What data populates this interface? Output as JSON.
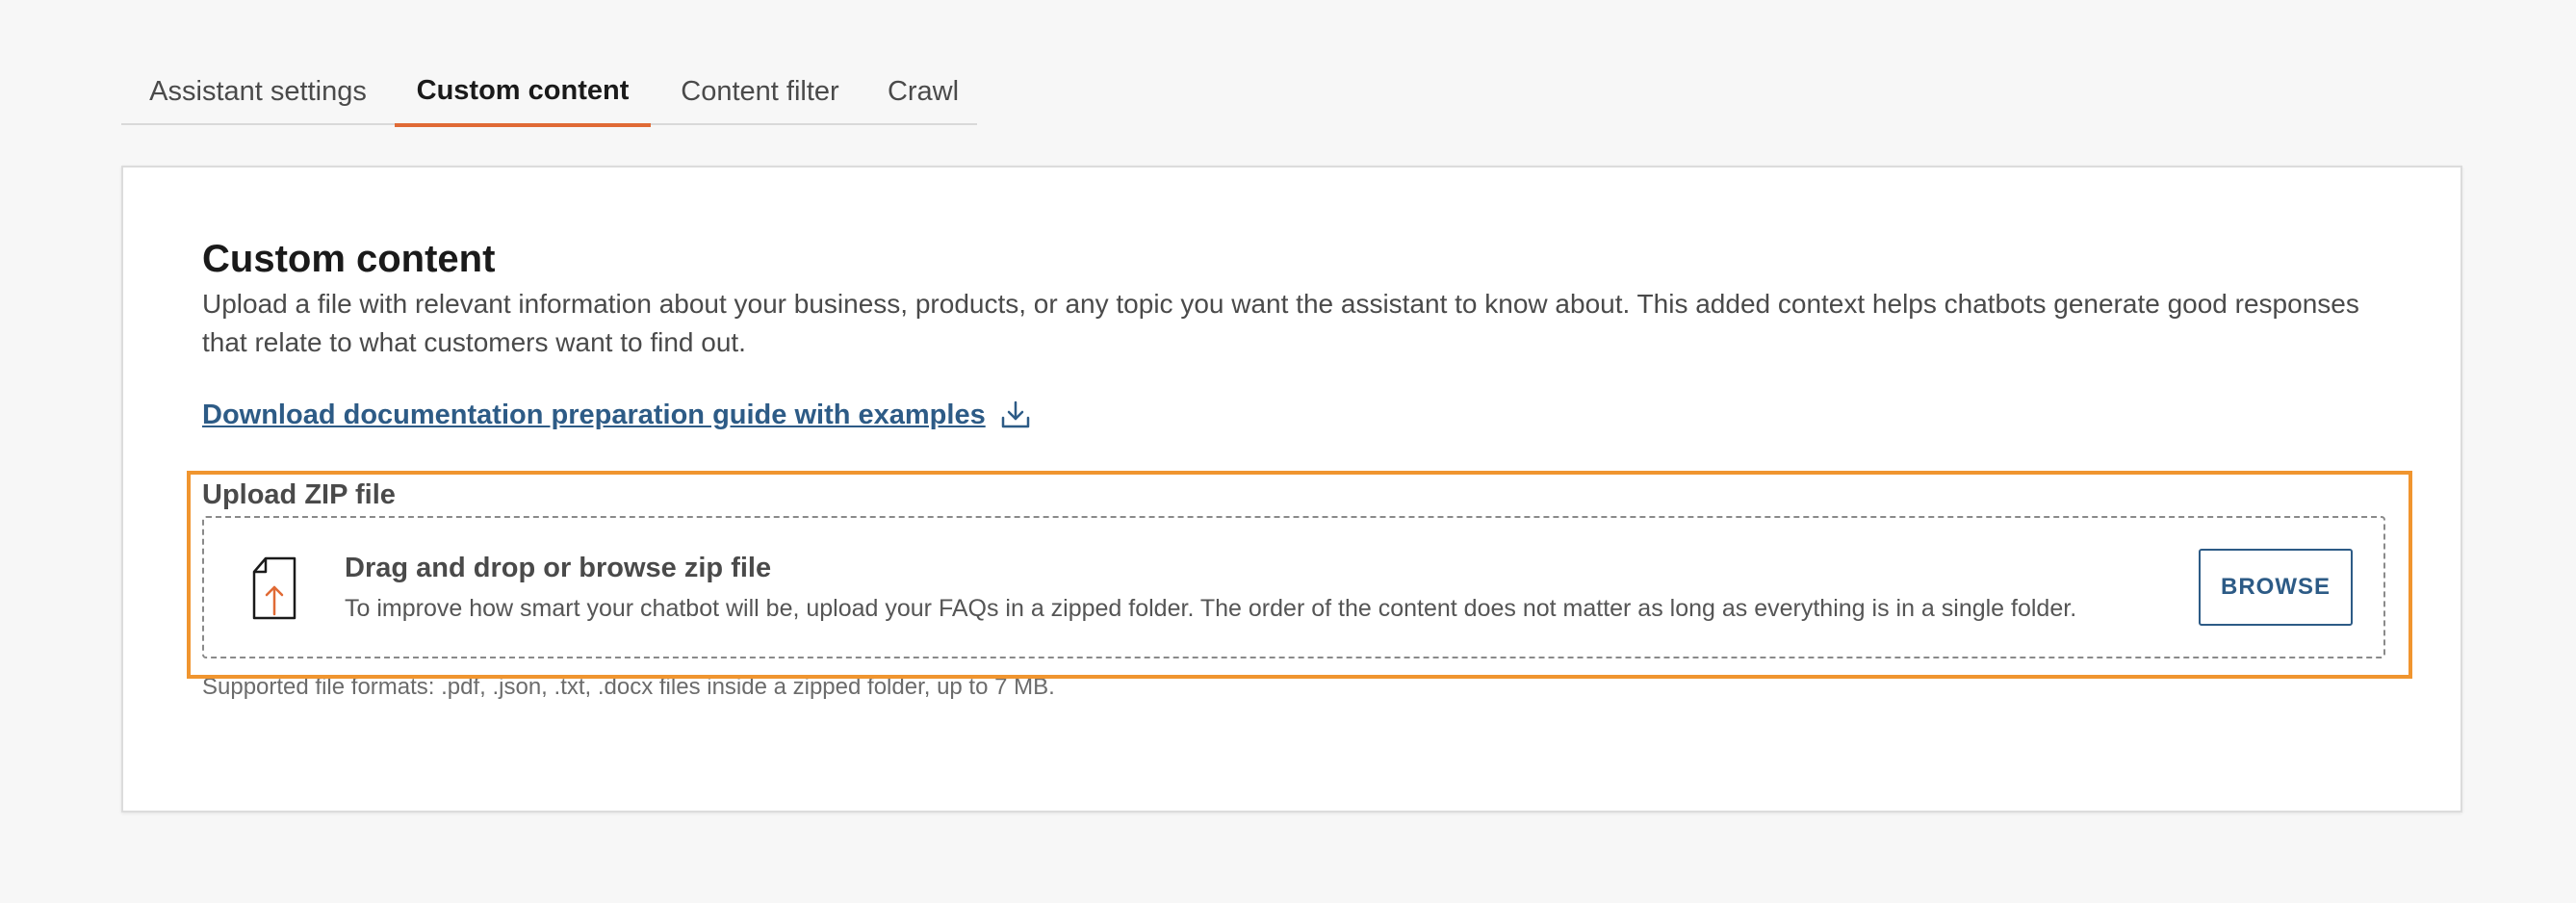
{
  "tabs": [
    {
      "label": "Assistant settings",
      "active": false
    },
    {
      "label": "Custom content",
      "active": true
    },
    {
      "label": "Content filter",
      "active": false
    },
    {
      "label": "Crawl",
      "active": false
    }
  ],
  "card": {
    "title": "Custom content",
    "description": "Upload a file with relevant information about your business, products, or any topic you want the assistant to know about. This added context helps chatbots generate good responses that relate to what customers want to find out.",
    "doc_link": "Download documentation preparation guide with examples",
    "doc_link_icon": "download-icon"
  },
  "upload": {
    "label": "Upload ZIP file",
    "dropzone_icon": "file-upload-icon",
    "dropzone_title": "Drag and drop or browse zip file",
    "dropzone_description": "To improve how smart your chatbot will be, upload your FAQs in a zipped folder. The order of the content does not matter as long as everything is in a single folder.",
    "browse_label": "BROWSE",
    "supported_formats": "Supported file formats: .pdf, .json, .txt, .docx files inside a zipped folder, up to 7 MB."
  },
  "colors": {
    "accent": "#e06a35",
    "link": "#2d5b86",
    "highlight": "#f0952f"
  }
}
